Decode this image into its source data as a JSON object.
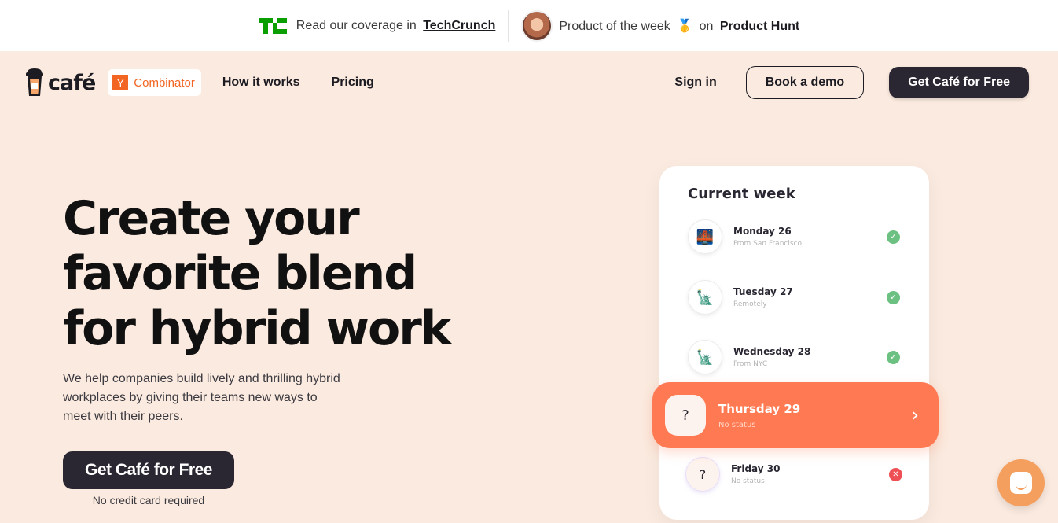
{
  "topbar": {
    "techcrunch_prefix": "Read our coverage in",
    "techcrunch_link": "TechCrunch",
    "ph_prefix": "Product of the week",
    "ph_on": "on",
    "ph_link": "Product Hunt",
    "medal": "🥇"
  },
  "header": {
    "logo_text": "café",
    "yc_letter": "Y",
    "yc_text": "Combinator",
    "nav": [
      "How it works",
      "Pricing"
    ],
    "signin": "Sign in",
    "book_demo": "Book a demo",
    "cta": "Get Café for Free"
  },
  "hero": {
    "title_lines": [
      "Create your",
      "favorite blend",
      "for hybrid work"
    ],
    "subtitle": "We help companies build lively and thrilling hybrid workplaces by giving their teams new ways to meet with their peers.",
    "cta": "Get Café for Free",
    "note": "No credit card required"
  },
  "week": {
    "title": "Current week",
    "days": [
      {
        "name": "Monday 26",
        "status": "From San Francisco",
        "icon": "🌉",
        "state": "check"
      },
      {
        "name": "Tuesday 27",
        "status": "Remotely",
        "icon": "🗽",
        "state": "check"
      },
      {
        "name": "Wednesday 28",
        "status": "From NYC",
        "icon": "🗽",
        "state": "check"
      }
    ],
    "highlight": {
      "name": "Thursday 29",
      "status": "No status",
      "icon": "?"
    },
    "last": {
      "name": "Friday 30",
      "status": "No status",
      "icon": "?",
      "state": "x"
    }
  },
  "colors": {
    "background": "#fbeadf",
    "dark": "#2a2632",
    "accent": "#ff7a52",
    "success": "#6cc182",
    "error": "#ee5055",
    "yc": "#f26522"
  }
}
